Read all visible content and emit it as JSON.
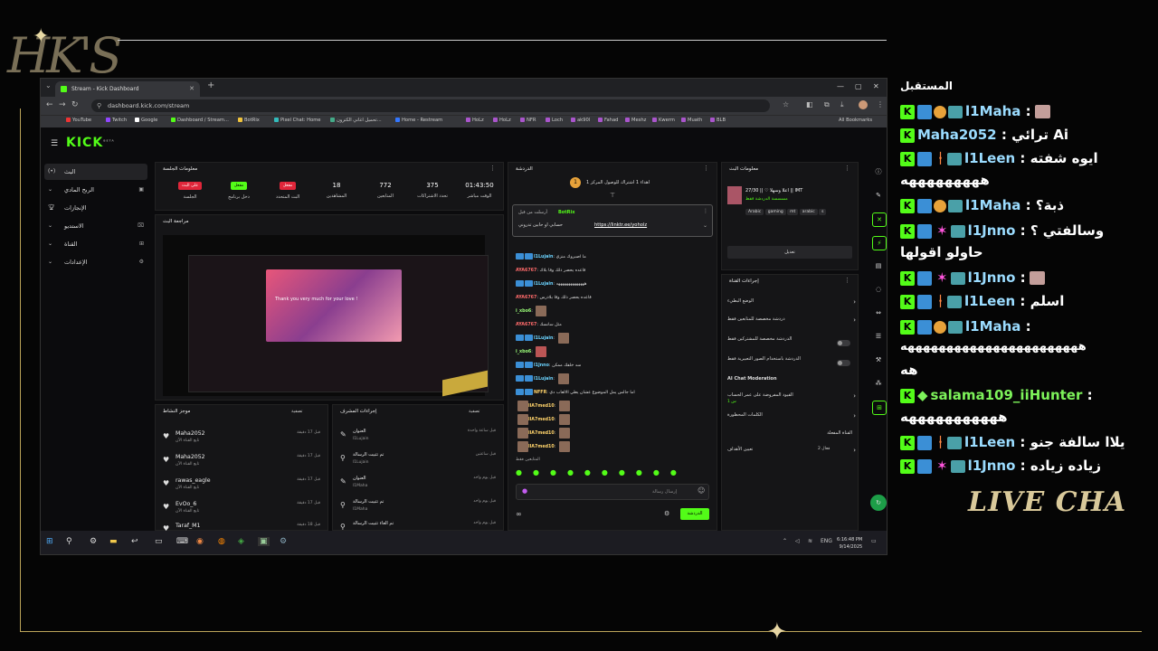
{
  "browser": {
    "tab_title": "Stream - Kick Dashboard",
    "url": "dashboard.kick.com/stream",
    "bookmarks": [
      "YouTube",
      "Twitch",
      "Google",
      "Dashboard / Stream...",
      "BotRix",
      "Pixel Chat: Home",
      "تحميل اغاني الكترون...",
      "Home - Restream",
      "HoLz",
      "HoLz",
      "NFR",
      "Loch",
      "ak90l",
      "Fahad",
      "Meshz",
      "Kwerm",
      "Muath",
      "BLB"
    ],
    "all_bookmarks": "All Bookmarks"
  },
  "kick": {
    "logo": "KICK",
    "logo_sup": "BETA",
    "sidebar": [
      {
        "label": "البث",
        "icon": "live-icon"
      },
      {
        "label": "الربح المادي",
        "icon": "money-icon"
      },
      {
        "label": "الإنجازات",
        "icon": "trophy-icon"
      },
      {
        "label": "الاستديو",
        "icon": "studio-icon"
      },
      {
        "label": "القناة",
        "icon": "channel-icon"
      },
      {
        "label": "الإعدادات",
        "icon": "gear-icon"
      }
    ],
    "session": {
      "title": "معلومات الجلسة",
      "stats": [
        {
          "value": "01:43:50",
          "label": "الوقت مباشر"
        },
        {
          "value": "375",
          "label": "تحدد الاشتراكات"
        },
        {
          "value": "772",
          "label": "المتابعين"
        },
        {
          "value": "18",
          "label": "المشاهدين"
        },
        {
          "badge": "مفعل",
          "label": "البث المتحدد"
        },
        {
          "badge": "مفعل",
          "label": "دخل برنامج"
        },
        {
          "badge": "على البث",
          "label": "الجلسة"
        }
      ]
    },
    "preview": {
      "title": "مراجعة البث",
      "overlay_text": "Thank you very much for your love !"
    },
    "feed": {
      "title": "موجز النشاط",
      "filter": "تصفية",
      "items": [
        {
          "name": "Maha2052",
          "sub": "تابع القناة الآن",
          "time": "قبل 17 دقيقة"
        },
        {
          "name": "Maha2052",
          "sub": "تابع القناة الآن",
          "time": "قبل 17 دقيقة"
        },
        {
          "name": "rawas_eagle",
          "sub": "تابع القناة الآن",
          "time": "قبل 17 دقيقة"
        },
        {
          "name": "EvOo_6",
          "sub": "تابع القناة الآن",
          "time": "قبل 17 دقيقة"
        },
        {
          "name": "Taraf_M1",
          "sub": "تابع القناة الآن",
          "time": "قبل 18 دقيقة"
        }
      ]
    },
    "modactions": {
      "title": "إجراءات المشرف",
      "filter": "تصفية",
      "items": [
        {
          "t1": "العنوان",
          "t2": "اعلا وسهلا ♡ || 28/30 من قبل IMT || تم تغيير ب إلى",
          "who": "l1Lujain",
          "time": "قبل ساعة واحدة"
        },
        {
          "t1": "تم تثبيت الرسالة",
          "t2": "من قبل",
          "who": "l1Lujain",
          "time": "قبل ساعتين"
        },
        {
          "t1": "العنوان",
          "t2": "اعلا وسهلا ♡ || 27/30 من قبل IMT || تم تغيير ب إلى",
          "who": "l1Maha",
          "time": "قبل يوم واحد"
        },
        {
          "t1": "تم تثبيت الرسالة",
          "t2": "من قبل",
          "who": "l1Maha",
          "time": "قبل يوم واحد"
        },
        {
          "t1": "تم الغاء تثبيت الرسالة",
          "t2": "من قبل",
          "who": "l1Maha",
          "time": "قبل يوم واحد"
        }
      ]
    },
    "chat": {
      "title": "الدردشة",
      "goal": "اهداء 1 اشتراك للوصول المركز 1",
      "pinned_by": "أرسلت من قبل",
      "pinned_user": "BotRix",
      "pinned_text": "حسابي او حابين تدروني",
      "pinned_link": "https://linktr.ee/yoholz",
      "messages": [
        {
          "user": "l1Lujain",
          "text": "ما اصبروك منزي"
        },
        {
          "user": "AYA6767",
          "text": "قاعده يحصر ذلك وقا بلاك"
        },
        {
          "user": "l1Lujain",
          "text": "ههههههههههههههه"
        },
        {
          "user": "AYA6767",
          "text": "قاعده يحصر ذلك وقا بلاذرس"
        },
        {
          "user": "i_xbo6",
          "text": ""
        },
        {
          "user": "AYA6767",
          "text": "مثل سانسك"
        },
        {
          "user": "l1Lujain",
          "text": ""
        },
        {
          "user": "i_xbo6",
          "text": ""
        },
        {
          "user": "l1Jnno",
          "text": "سد خلفك ممكن"
        },
        {
          "user": "l1Lujain",
          "text": ""
        },
        {
          "user": "NFFR",
          "text": "اما جالس يمل الموضوع عشان يطي الالعاب دي"
        },
        {
          "user": "llA7med10",
          "text": ""
        },
        {
          "user": "llA7med10",
          "text": ""
        },
        {
          "user": "llA7med10",
          "text": ""
        },
        {
          "user": "llA7med10",
          "text": ""
        }
      ],
      "paused": "المتابعين فقط",
      "input_placeholder": "إرسال رسالة",
      "send": "الدردشة"
    },
    "streaminfo": {
      "title": "معلومات البث",
      "stream_title": "اعلا وسهلا ♡ || 27/30 || IMT",
      "category": "مسسسة الدردشة فقط",
      "tags": [
        "Arabic",
        "gaming",
        "mt",
        "arabic",
        "s"
      ],
      "edit": "تعديل"
    },
    "channelactions": {
      "title": "إجراءات القناة",
      "rows": [
        "الوضع البطيء",
        "دردشة مخصصة للمتابعين فقط",
        "الدردشة مخصصة للمشتركين فقط",
        "الدردشة باستخدام الصور التعبيرية فقط",
        "AI Chat Moderation",
        "القيود المفروضة على عمر الحساب",
        "الكلمات المحظورة",
        "القناة المفعلة",
        "تعيين الأهداف"
      ],
      "account_age_value": "1 س",
      "goal_value": "فعال 2"
    },
    "clock": {
      "time": "6:16:48 PM",
      "date": "9/14/2025"
    },
    "lang": "ENG"
  },
  "overlay_chat": {
    "lines": [
      {
        "user": "",
        "text": "المستقبل"
      },
      {
        "user": "l1Maha",
        "text": ":",
        "emote": true
      },
      {
        "user": "Maha2052",
        "text": ": ترائي Ai"
      },
      {
        "user": "l1Leen",
        "text": ": ايوه شفته"
      },
      {
        "user": "",
        "text": "هههههههههه"
      },
      {
        "user": "l1Maha",
        "text": ": ذبة؟"
      },
      {
        "user": "l1Jnno",
        "text": ": وسالفتي ؟"
      },
      {
        "user": "",
        "text": "حاولو اقولها"
      },
      {
        "user": "l1Jnno",
        "text": ":",
        "emote": true
      },
      {
        "user": "l1Leen",
        "text": ": اسلم"
      },
      {
        "user": "l1Maha",
        "text": ":"
      },
      {
        "user": "",
        "text": "هههههههههههههههههههههههه"
      },
      {
        "user": "",
        "text": "هه"
      },
      {
        "user": "salama109_iiHunter",
        "text": ":"
      },
      {
        "user": "",
        "text": "هههههههههههه"
      },
      {
        "user": "l1Leen",
        "text": ": يلاا سالفة جنو"
      },
      {
        "user": "l1Jnno",
        "text": ": زياده زياده"
      }
    ],
    "footer": "LIVE CHA"
  },
  "colors": {
    "kick_green": "#53fc18",
    "accent_red": "#e0263a",
    "gold": "#d8c79a"
  }
}
